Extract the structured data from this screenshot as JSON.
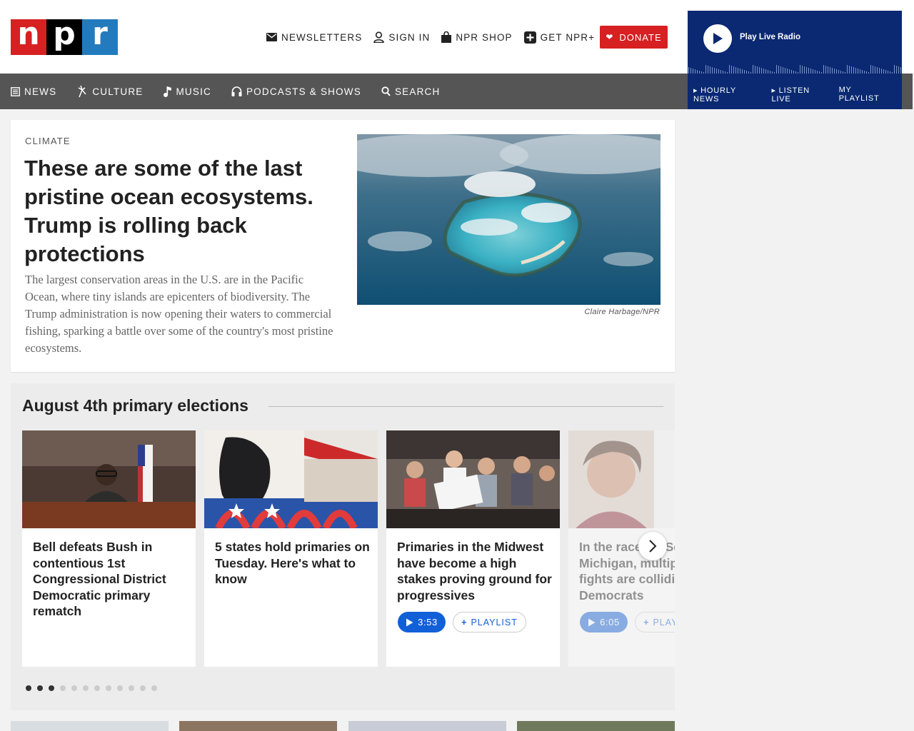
{
  "logo": {
    "letters": [
      "n",
      "p",
      "r"
    ]
  },
  "header": {
    "links": [
      {
        "label": "NEWSLETTERS",
        "icon": "mail-icon"
      },
      {
        "label": "SIGN IN",
        "icon": "user-icon"
      },
      {
        "label": "NPR SHOP",
        "icon": "shopping-bag-icon"
      },
      {
        "label": "GET NPR+",
        "icon": "plus-square-icon"
      }
    ],
    "donate_label": "DONATE"
  },
  "player": {
    "label": "Play Live Radio",
    "links": [
      "▸ HOURLY NEWS",
      "▸ LISTEN LIVE",
      "MY PLAYLIST"
    ]
  },
  "nav": {
    "items": [
      {
        "label": "NEWS",
        "icon": "newspaper-icon"
      },
      {
        "label": "CULTURE",
        "icon": "culture-icon"
      },
      {
        "label": "MUSIC",
        "icon": "music-note-icon"
      },
      {
        "label": "PODCASTS & SHOWS",
        "icon": "headphones-icon"
      },
      {
        "label": "SEARCH",
        "icon": "search-icon"
      }
    ]
  },
  "hero": {
    "kicker": "CLIMATE",
    "title": "These are some of the last pristine ocean ecosystems. Trump is rolling back protections",
    "teaser": "The largest conservation areas in the U.S. are in the Pacific Ocean, where tiny islands are epicenters of biodiversity. The Trump administration is now opening their waters to commercial fishing, sparking a battle over some of the country's most pristine ecosystems.",
    "credit": "Claire Harbage/NPR"
  },
  "section": {
    "title": "August 4th primary elections",
    "cards": [
      {
        "title": "Bell defeats Bush in contentious 1st Congressional District Democratic primary rematch"
      },
      {
        "title": "5 states hold primaries on Tuesday. Here's what to know"
      },
      {
        "title": "Primaries in the Midwest have become a high stakes proving ground for progressives",
        "duration": "3:53",
        "playlist": "PLAYLIST"
      },
      {
        "title": "In the race for Senate in Michigan, multiple party fights are colliding for Democrats",
        "duration": "6:05",
        "playlist": "PLAYLIST"
      }
    ],
    "dots_total": 12,
    "dots_active": [
      0,
      1,
      2
    ]
  },
  "colors": {
    "npr_red": "#d62021",
    "npr_blue": "#237bbd",
    "player_navy": "#0a2972",
    "nav_gray": "#555555",
    "audio_blue": "#1160d8"
  }
}
